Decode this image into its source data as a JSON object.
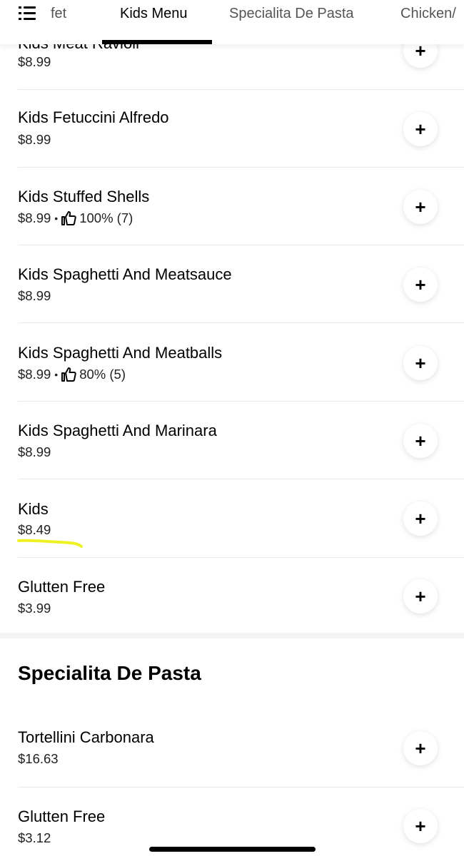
{
  "nav": {
    "tabs": [
      {
        "label": "fet"
      },
      {
        "label": "Kids Menu",
        "active": true
      },
      {
        "label": "Specialita De Pasta"
      },
      {
        "label": "Chicken/"
      }
    ]
  },
  "items": [
    {
      "name": "Kids Meat Ravioli",
      "price": "$8.99"
    },
    {
      "name": "Kids Fetuccini Alfredo",
      "price": "$8.99"
    },
    {
      "name": "Kids Stuffed Shells",
      "price": "$8.99",
      "rating": "100% (7)"
    },
    {
      "name": "Kids Spaghetti And Meatsauce",
      "price": "$8.99"
    },
    {
      "name": "Kids Spaghetti And Meatballs",
      "price": "$8.99",
      "rating": "80% (5)"
    },
    {
      "name": "Kids Spaghetti And Marinara",
      "price": "$8.99"
    },
    {
      "name": "Kids",
      "price": "$8.49"
    },
    {
      "name": "Glutten Free",
      "price": "$3.99"
    }
  ],
  "section": {
    "title": "Specialita De Pasta"
  },
  "section_items": [
    {
      "name": "Tortellini Carbonara",
      "price": "$16.63"
    },
    {
      "name": "Glutten Free",
      "price": "$3.12"
    }
  ],
  "add_label": "+",
  "separator": "•",
  "colors": {
    "highlight": "#eef224",
    "divider": "#e8e8e8",
    "section_band": "#f3f3f3"
  }
}
